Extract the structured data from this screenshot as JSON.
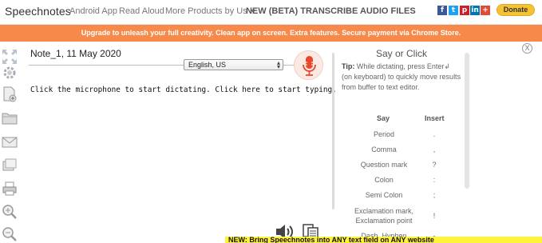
{
  "nav": {
    "brand": "Speechnotes",
    "links": [
      "Android App",
      "Read Aloud",
      "More Products by Us",
      "NEW (BETA) TRANSCRIBE AUDIO FILES"
    ],
    "social": [
      {
        "icon": "facebook-icon",
        "glyph": "f",
        "color": "#3b5998"
      },
      {
        "icon": "twitter-icon",
        "glyph": "t",
        "color": "#1da1f2"
      },
      {
        "icon": "pinterest-icon",
        "glyph": "p",
        "color": "#cb2027"
      },
      {
        "icon": "linkedin-icon",
        "glyph": "in",
        "color": "#0077b5"
      },
      {
        "icon": "google-plus-icon",
        "glyph": "+",
        "color": "#dd4b39"
      }
    ],
    "donate": "Donate",
    "donate_color": "#f5c332"
  },
  "banner": {
    "text": "Upgrade to unleash your full creativity. Clean app on screen. Extra features. Secure payment via Chrome Store.",
    "color": "#f78a4b"
  },
  "toolbar_icons": [
    "expand-icon",
    "settings-gear-icon",
    "new-document-icon",
    "open-folder-icon",
    "email-icon",
    "save-icon",
    "print-icon",
    "zoom-in-icon",
    "zoom-out-icon"
  ],
  "editor": {
    "title": "Note_1, 11 May 2020",
    "language": "English, US",
    "placeholder_text": "Click the microphone to start dictating. Click here to start typing."
  },
  "panel": {
    "title": "Say or Click",
    "tip_label": "Tip:",
    "tip_text": "While dictating, press Enter↲ (on keyboard) to quickly move results from buffer to text editor.",
    "col_say": "Say",
    "col_insert": "Insert",
    "commands": [
      {
        "say": "Period",
        "insert": "."
      },
      {
        "say": "Comma",
        "insert": ","
      },
      {
        "say": "Question mark",
        "insert": "?"
      },
      {
        "say": "Colon",
        "insert": ":"
      },
      {
        "say": "Semi Colon",
        "insert": ";"
      },
      {
        "say": "Exclamation mark, Exclamation point",
        "insert": "!"
      },
      {
        "say": "Dash, Hyphen",
        "insert": "-"
      }
    ]
  },
  "notice": {
    "text": "NEW: Bring Speechnotes into ANY text field on ANY website",
    "color": "#fff23a"
  }
}
